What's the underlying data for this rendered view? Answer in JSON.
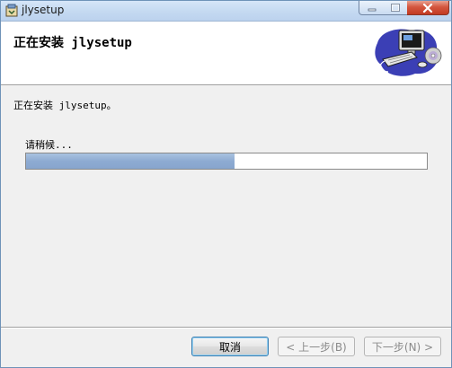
{
  "window": {
    "title": "jlysetup",
    "controls": {
      "minimize": "minimize-icon",
      "maximize": "maximize-icon",
      "close": "close-icon"
    }
  },
  "header": {
    "title": "正在安装 jlysetup",
    "art_icon": "computer-installing-icon"
  },
  "body": {
    "status_text": "正在安装 jlysetup。",
    "wait_text": "请稍候...",
    "progress_fraction": 0.52
  },
  "buttons": {
    "cancel": "取消",
    "back": "< 上一步(B)",
    "next": "下一步(N) >"
  },
  "colors": {
    "progress_fill": "#8eabd2",
    "close_button": "#c23a22",
    "titlebar": "#c4d9f1"
  }
}
